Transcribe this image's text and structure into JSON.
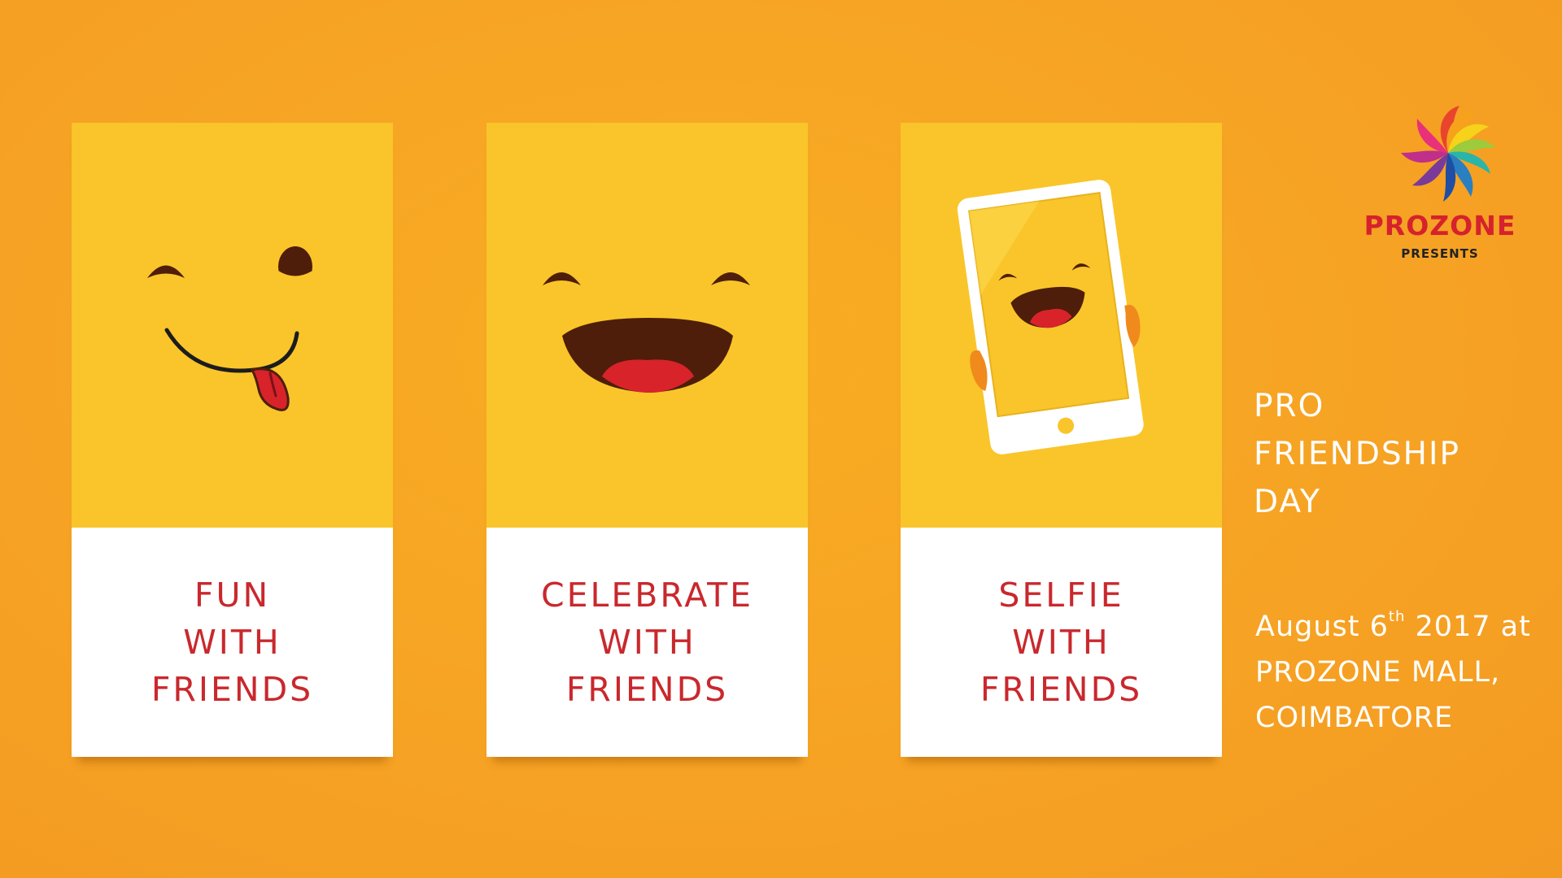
{
  "cards": [
    {
      "name": "fun",
      "lines": [
        "FUN",
        "WITH",
        "FRIENDS"
      ],
      "icon": "tongue-out-smiley-icon"
    },
    {
      "name": "celebrate",
      "lines": [
        "CELEBRATE",
        "WITH",
        "FRIENDS"
      ],
      "icon": "laughing-smiley-icon"
    },
    {
      "name": "selfie",
      "lines": [
        "SELFIE",
        "WITH",
        "FRIENDS"
      ],
      "icon": "smiling-phone-icon"
    }
  ],
  "brand": {
    "name": "PROZONE",
    "tagline": "PRESENTS",
    "logo_icon": "pinwheel-logo-icon",
    "logo_text_color": "#d6222d"
  },
  "event": {
    "title_lines": [
      "PRO",
      "FRIENDSHIP",
      "DAY"
    ],
    "date_prefix": "August 6",
    "date_suffix": "th",
    "date_rest": " 2017 at",
    "venue_line1": "PROZONE MALL,",
    "venue_line2": "COIMBATORE"
  },
  "colors": {
    "background": "#f7a524",
    "card_yellow": "#f9c52a",
    "card_text_red": "#c9282d",
    "face_brown": "#4e1e0a",
    "tongue_red": "#d8232a"
  }
}
